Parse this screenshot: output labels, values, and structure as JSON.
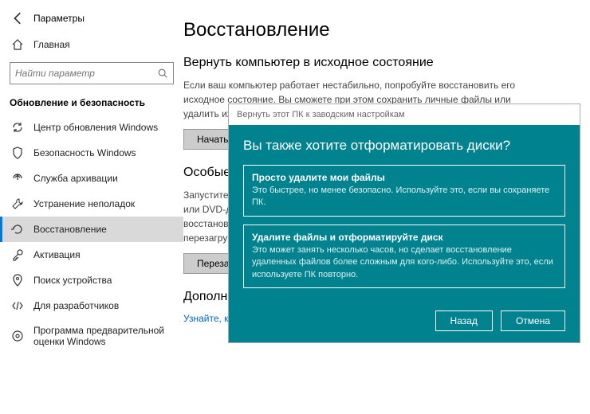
{
  "window": {
    "title": "Параметры"
  },
  "sidebar": {
    "home": "Главная",
    "search_placeholder": "Найти параметр",
    "section": "Обновление и безопасность",
    "items": [
      {
        "label": "Центр обновления Windows"
      },
      {
        "label": "Безопасность Windows"
      },
      {
        "label": "Служба архивации"
      },
      {
        "label": "Устранение неполадок"
      },
      {
        "label": "Восстановление"
      },
      {
        "label": "Активация"
      },
      {
        "label": "Поиск устройства"
      },
      {
        "label": "Для разработчиков"
      },
      {
        "label": "Программа предварительной оценки Windows"
      }
    ]
  },
  "main": {
    "title": "Восстановление",
    "reset": {
      "heading": "Вернуть компьютер в исходное состояние",
      "body": "Если ваш компьютер работает нестабильно, попробуйте восстановить его исходное состояние. Вы сможете при этом сохранить личные файлы или удалить их, а затем переустановить Windows.",
      "button": "Начать"
    },
    "advanced": {
      "heading": "Особые варианты загрузки",
      "body": "Запустите систему с устройства либо диска (например, USB-накопителя или DVD-диска), измените параметры загрузки ПО компьютера или восстановите Windows из образа системы. Ваш компьютер будет перезагружен.",
      "button": "Перезагрузить сейчас"
    },
    "more": {
      "heading": "Дополнительные параметры восстановления",
      "link": "Узнайте, как начать заново с чистой установкой Windows"
    }
  },
  "modal": {
    "caption": "Вернуть этот ПК к заводским настройкам",
    "title": "Вы также хотите отформатировать диски?",
    "options": [
      {
        "title": "Просто удалите мои файлы",
        "desc": "Это быстрее, но менее безопасно. Используйте это, если вы сохраняете ПК."
      },
      {
        "title": "Удалите файлы и отформатируйте диск",
        "desc": "Это может занять несколько часов, но сделает восстановление удаленных файлов более сложным для кого-либо. Используйте это, если используете ПК повторно."
      }
    ],
    "back": "Назад",
    "cancel": "Отмена"
  }
}
